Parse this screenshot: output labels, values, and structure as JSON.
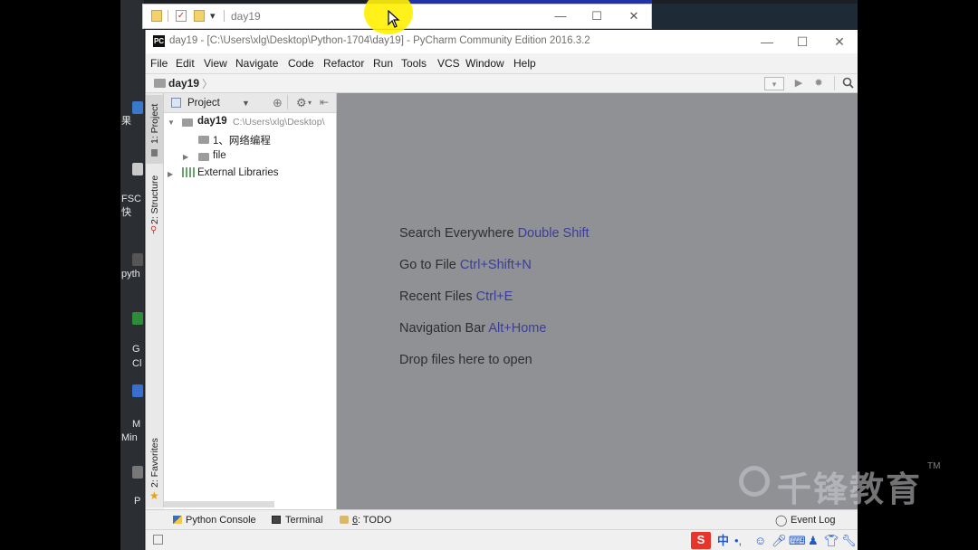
{
  "explorer": {
    "title": "day19",
    "pin_symbol": "▾"
  },
  "window": {
    "title": "day19 - [C:\\Users\\xlg\\Desktop\\Python-1704\\day19] - PyCharm Community Edition 2016.3.2",
    "logo_text": "PC",
    "minimize": "—",
    "maximize": "☐",
    "close": "✕"
  },
  "menu": [
    "File",
    "Edit",
    "View",
    "Navigate",
    "Code",
    "Refactor",
    "Run",
    "Tools",
    "VCS",
    "Window",
    "Help"
  ],
  "navbar": {
    "crumb": "day19",
    "chevron": "〉"
  },
  "side_tabs": {
    "project": "1: Project",
    "structure": "2: Structure",
    "favorites": "2: Favorites"
  },
  "project_panel": {
    "view_selector": "Project",
    "root_name": "day19",
    "root_path": "C:\\Users\\xlg\\Desktop\\",
    "items": [
      {
        "label": "1、网络编程",
        "expandable": false
      },
      {
        "label": "file",
        "expandable": true
      },
      {
        "label": "External Libraries",
        "expandable": true
      }
    ]
  },
  "editor_hints": [
    {
      "text": "Search Everywhere",
      "key": "Double Shift"
    },
    {
      "text": "Go to File",
      "key": "Ctrl+Shift+N"
    },
    {
      "text": "Recent Files",
      "key": "Ctrl+E"
    },
    {
      "text": "Navigation Bar",
      "key": "Alt+Home"
    },
    {
      "text": "Drop files here to open",
      "key": ""
    }
  ],
  "bottom_tools": {
    "python_console": "Python Console",
    "terminal": "Terminal",
    "todo_num": "6",
    "todo": ": TODO",
    "event_log": "Event Log"
  },
  "ime": {
    "logo": "S",
    "lang": "中",
    "punct": "•,"
  },
  "desktop_labels": [
    "果",
    "FSC",
    "快",
    "pyth",
    "G",
    "Cl",
    "M",
    "Min",
    "P"
  ],
  "watermark": {
    "text": "千锋教育",
    "tm": "TM"
  },
  "colors": {
    "editor_bg": "#8f9194",
    "shortcut": "#3d3d99",
    "highlight": "#fff000"
  }
}
